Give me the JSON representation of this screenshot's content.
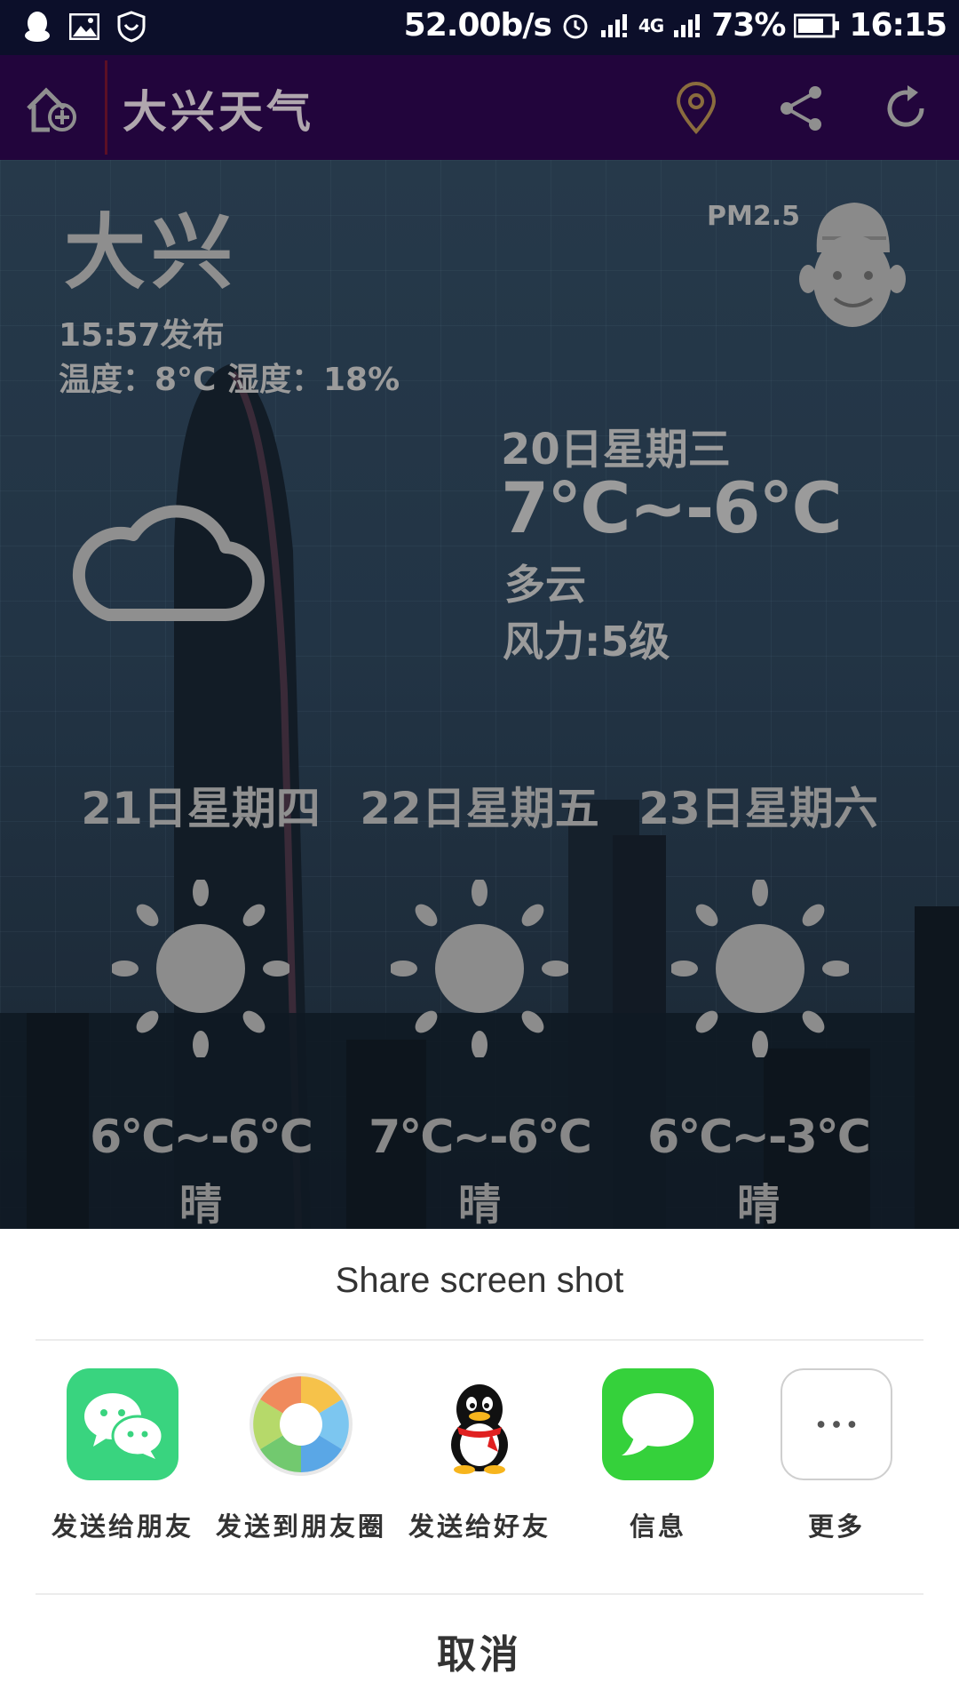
{
  "status_bar": {
    "net_speed": "52.00b/s",
    "network": "4G",
    "battery": "73%",
    "time": "16:15"
  },
  "app_bar": {
    "title": "大兴天气"
  },
  "current": {
    "city": "大兴",
    "pm_label": "PM2.5",
    "publish_time": "15:57发布",
    "temp_humidity": "温度：8°C  湿度：18%",
    "today_date": "20日星期三",
    "today_range": "7°C~-6°C",
    "today_condition": "多云",
    "today_wind": "风力:5级"
  },
  "forecast": [
    {
      "day": "21日星期四",
      "range": "6°C~-6°C",
      "condition": "晴"
    },
    {
      "day": "22日星期五",
      "range": "7°C~-6°C",
      "condition": "晴"
    },
    {
      "day": "23日星期六",
      "range": "6°C~-3°C",
      "condition": "晴"
    }
  ],
  "share_sheet": {
    "title": "Share screen shot",
    "items": [
      {
        "label": "发送给朋友",
        "icon": "wechat-icon"
      },
      {
        "label": "发送到朋友圈",
        "icon": "moments-icon"
      },
      {
        "label": "发送给好友",
        "icon": "qq-icon"
      },
      {
        "label": "信息",
        "icon": "message-icon"
      },
      {
        "label": "更多",
        "icon": "more-icon"
      }
    ],
    "cancel": "取消"
  },
  "colors": {
    "app_bar": "#22053c",
    "status_bar": "#0c0f2a",
    "wechat_green": "#39d47f",
    "message_green": "#35d13b"
  }
}
